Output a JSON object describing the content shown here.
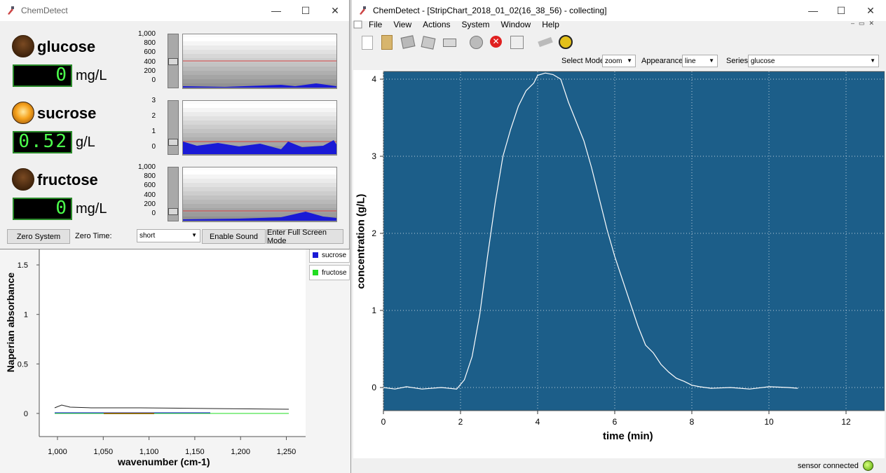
{
  "left_window": {
    "title": "ChemDetect",
    "sensors": [
      {
        "name": "glucose",
        "value": "0",
        "unit": "mg/L",
        "led": "off",
        "yticks": [
          "1,000",
          "800",
          "600",
          "400",
          "200",
          "0"
        ],
        "level": 0.0
      },
      {
        "name": "sucrose",
        "value": "0.52",
        "unit": "g/L",
        "led": "on",
        "yticks": [
          "3",
          "2",
          "1",
          "0"
        ],
        "level": 0.17
      },
      {
        "name": "fructose",
        "value": "0",
        "unit": "mg/L",
        "led": "off",
        "yticks": [
          "1,000",
          "800",
          "600",
          "400",
          "200",
          "0"
        ],
        "level": 0.0
      }
    ],
    "buttons": {
      "zero_system": "Zero System",
      "zero_time_label": "Zero Time:",
      "zero_time_value": "short",
      "enable_sound": "Enable Sound",
      "full_screen": "Enter Full Screen Mode"
    }
  },
  "spectrum_panel": {
    "ylabel": "Naperian absorbance",
    "xlabel": "wavenumber (cm-1)",
    "yticks": [
      "1.5",
      "1",
      "0.5",
      "0"
    ],
    "xticks": [
      "1,000",
      "1,050",
      "1,100",
      "1,150",
      "1,200",
      "1,250"
    ],
    "legend": [
      {
        "name": "sucrose",
        "color": "#1a1ad6"
      },
      {
        "name": "fructose",
        "color": "#22dd22"
      }
    ]
  },
  "right_window": {
    "title": "ChemDetect - [StripChart_2018_01_02(16_38_56) - collecting]",
    "menu": [
      "File",
      "View",
      "Actions",
      "System",
      "Window",
      "Help"
    ],
    "select_mode_label": "Select Mode",
    "select_mode_value": "zoom",
    "appearance_label": "Appearance",
    "appearance_value": "line",
    "series_label": "Series",
    "series_value": "glucose",
    "status": "sensor connected",
    "icons": [
      "new-icon",
      "open-icon",
      "save-icon",
      "save-as-icon",
      "print-icon",
      "connect-icon",
      "stop-icon",
      "zoom-icon",
      "probe-icon",
      "bee-icon"
    ]
  },
  "colors": {
    "plot_bg": "#1c5e89",
    "accent_green": "#4cff4c",
    "series_blue": "#1a1ad6"
  },
  "chart_data": {
    "type": "line",
    "xlabel": "time (min)",
    "ylabel": "concentration (g/L)",
    "xlim": [
      0,
      13
    ],
    "ylim": [
      -0.3,
      4.1
    ],
    "xticks": [
      0,
      2,
      4,
      6,
      8,
      10,
      12
    ],
    "yticks": [
      0,
      1,
      2,
      3,
      4
    ],
    "grid": true,
    "series": [
      {
        "name": "glucose",
        "x": [
          0,
          0.3,
          0.6,
          1.0,
          1.5,
          1.9,
          2.1,
          2.3,
          2.5,
          2.7,
          2.9,
          3.1,
          3.3,
          3.5,
          3.7,
          3.9,
          4.0,
          4.2,
          4.4,
          4.6,
          4.8,
          5.0,
          5.2,
          5.4,
          5.6,
          5.8,
          6.0,
          6.2,
          6.4,
          6.6,
          6.8,
          7.0,
          7.2,
          7.4,
          7.6,
          7.8,
          8.0,
          8.2,
          8.5,
          9.0,
          9.5,
          10.0,
          10.5,
          10.75
        ],
        "y": [
          0.0,
          -0.02,
          0.01,
          -0.02,
          0.0,
          -0.02,
          0.1,
          0.4,
          0.95,
          1.7,
          2.4,
          3.0,
          3.35,
          3.65,
          3.85,
          3.95,
          4.05,
          4.08,
          4.06,
          4.0,
          3.7,
          3.45,
          3.2,
          2.85,
          2.45,
          2.05,
          1.7,
          1.4,
          1.1,
          0.8,
          0.55,
          0.45,
          0.3,
          0.2,
          0.12,
          0.08,
          0.03,
          0.01,
          -0.01,
          0.0,
          -0.02,
          0.01,
          0.0,
          -0.01
        ]
      }
    ]
  }
}
